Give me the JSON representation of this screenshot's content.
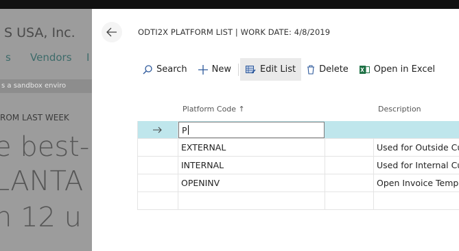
{
  "background": {
    "company": "S USA, Inc.",
    "nav_items": [
      "s",
      "Vendors",
      "I"
    ],
    "sandbox_notice": "s a sandbox enviro",
    "headline": "ROM LAST WEEK",
    "big_lines": [
      "e best-",
      "LANTA",
      "n 12 u"
    ]
  },
  "dialog": {
    "title": "ODTI2X PLATFORM LIST | WORK DATE: 4/8/2019",
    "toolbar": {
      "search": "Search",
      "new": "New",
      "edit_list": "Edit List",
      "delete": "Delete",
      "open_excel": "Open in Excel"
    },
    "columns": {
      "code": "Platform Code ↑",
      "description": "Description"
    },
    "editing_value": "P",
    "rows": [
      {
        "code": "EXTERNAL",
        "description": "Used for Outside Customers"
      },
      {
        "code": "INTERNAL",
        "description": "Used for Internal Customers"
      },
      {
        "code": "OPENINV",
        "description": "Open Invoice Template"
      }
    ]
  },
  "colors": {
    "selected_row": "#bfe6ec",
    "excel_green": "#1e7145",
    "accent": "#2b579a"
  }
}
